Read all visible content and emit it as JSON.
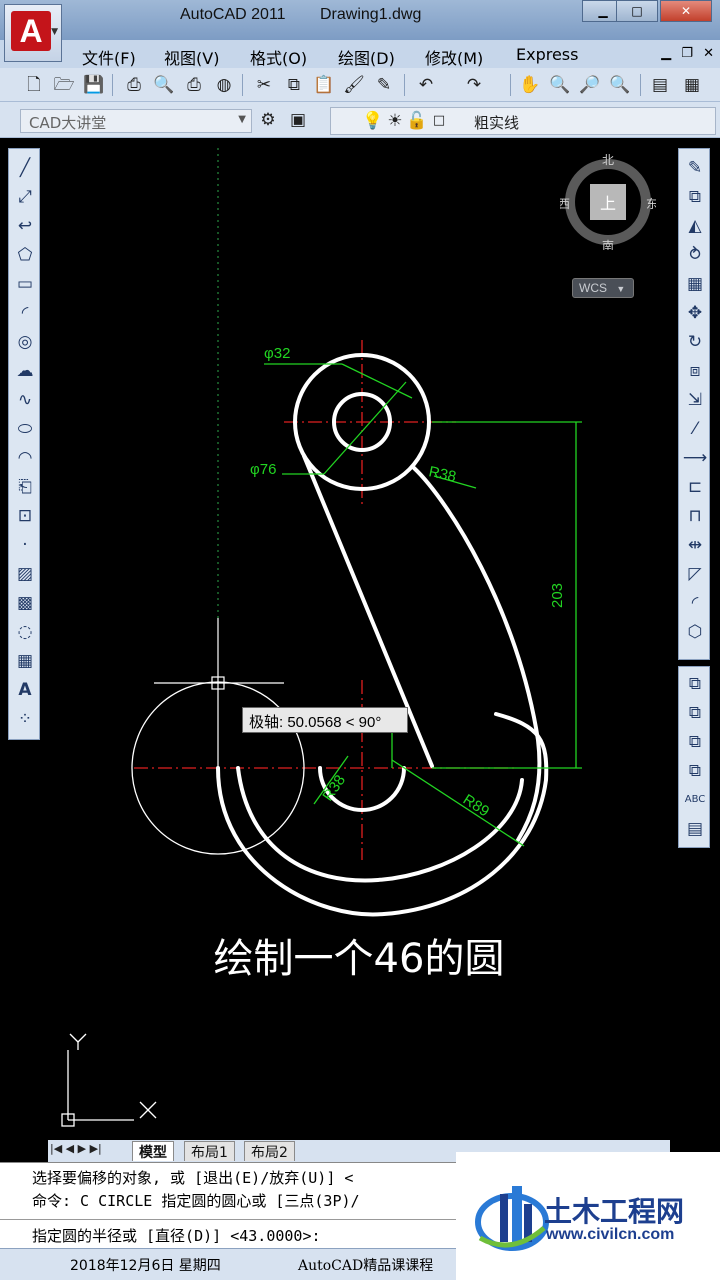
{
  "window": {
    "app_name": "AutoCAD 2011",
    "file_name": "Drawing1.dwg",
    "minimize": "▁",
    "maximize": "□",
    "close": "✕"
  },
  "menu": [
    "文件(F)",
    "视图(V)",
    "格式(O)",
    "绘图(D)",
    "修改(M)",
    "Express"
  ],
  "toolbar": {
    "workspace": "CAD大讲堂",
    "layer_name": "粗实线"
  },
  "viewcube": {
    "north": "北",
    "south": "南",
    "east": "东",
    "west": "西",
    "face": "上",
    "wcs": "WCS"
  },
  "drawing": {
    "dims": {
      "d32": "φ32",
      "d76": "φ76",
      "r38_top": "R38",
      "r38_bottom": "R38",
      "r89": "R89",
      "len203": "203"
    },
    "polar_tooltip": "极轴: 50.0568 < 90°",
    "subtitle": "绘制一个46的圆",
    "ucs_x": "X",
    "ucs_y": "Y"
  },
  "tabs": {
    "nav": "|◀ ◀ ▶ ▶|",
    "model": "模型",
    "layout1": "布局1",
    "layout2": "布局2"
  },
  "command": {
    "line1": "选择要偏移的对象, 或 [退出(E)/放弃(U)] <",
    "line2": "命令: C CIRCLE 指定圆的圆心或 [三点(3P)/",
    "line3": "指定圆的半径或 [直径(D)] <43.0000>:"
  },
  "status": {
    "date": "2018年12月6日 星期四",
    "course": "AutoCAD精品课课程"
  },
  "watermark": {
    "name": "土木工程网",
    "url": "www.civilcn.com"
  },
  "colors": {
    "canvas_bg": "#000000",
    "geometry": "#ffffff",
    "dimension": "#22d422",
    "centerline": "#e02020"
  }
}
